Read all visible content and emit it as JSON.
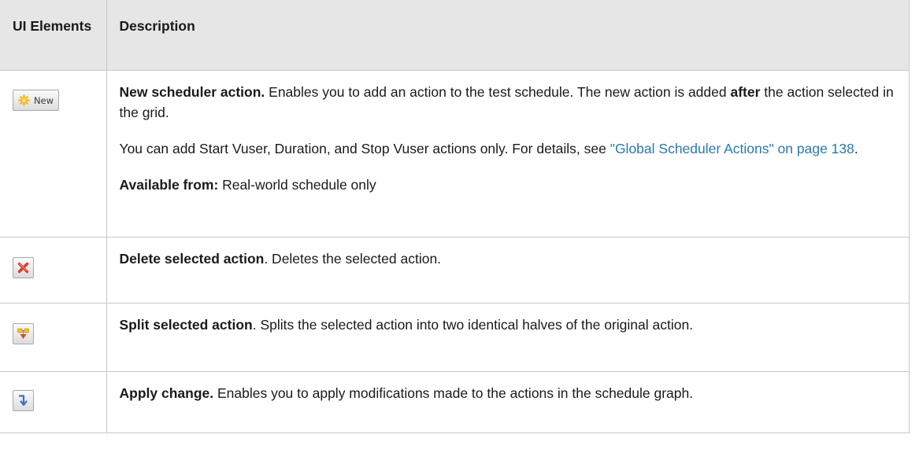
{
  "header": {
    "col_ui_elements": "UI Elements",
    "col_description": "Description"
  },
  "rows": [
    {
      "icon": "new-star-icon",
      "button_text": "New",
      "title": "New scheduler action.",
      "text_a": " Enables you to add an action to the test schedule. The new action is added ",
      "emphasis": "after",
      "text_b": " the action selected in the grid.",
      "para2_text": "You can add Start Vuser, Duration, and Stop Vuser actions only. For details, see ",
      "para2_link": "\"Global Scheduler Actions\" on page 138",
      "para2_end": ".",
      "available_label": "Available from:",
      "available_value": " Real-world schedule only"
    },
    {
      "icon": "delete-x-icon",
      "title": "Delete selected action",
      "text": ". Deletes the selected action."
    },
    {
      "icon": "split-icon",
      "title": "Split selected action",
      "text": ". Splits the selected action into two identical halves of the original action."
    },
    {
      "icon": "apply-change-icon",
      "title": "Apply change.",
      "text": " Enables you to apply modifications made to the actions in the schedule graph."
    }
  ],
  "colors": {
    "header_bg": "#e6e6e6",
    "border": "#c8c8c8",
    "link": "#2a79ad",
    "delete_red": "#d93a2b",
    "split_yellow": "#f2c12e",
    "split_red": "#d9443a",
    "apply_blue": "#3a6fc4"
  }
}
